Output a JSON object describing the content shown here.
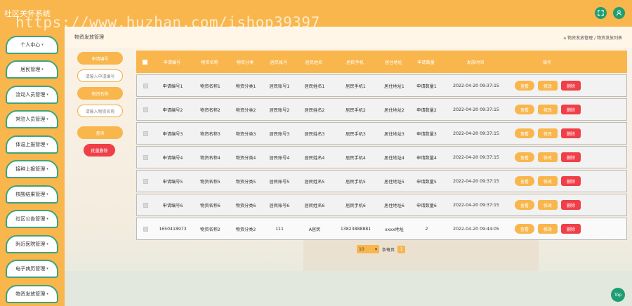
{
  "app": {
    "title": "社区关怀系统",
    "watermark": "https://www.huzhan.com/ishop39397"
  },
  "topbar": {
    "icons": [
      "fullscreen-icon",
      "user-icon"
    ]
  },
  "sidebar": {
    "items": [
      {
        "label": "个人中心"
      },
      {
        "label": "居民管理"
      },
      {
        "label": "流动人员管理"
      },
      {
        "label": "常驻人员管理"
      },
      {
        "label": "体温上报管理"
      },
      {
        "label": "接种上报管理"
      },
      {
        "label": "核酸结果管理"
      },
      {
        "label": "社区公告管理"
      },
      {
        "label": "附近医院管理"
      },
      {
        "label": "电子病历管理"
      },
      {
        "label": "物资发放管理"
      }
    ]
  },
  "page": {
    "title": "物资发放管理",
    "breadcrumb": "物资发放管理 / 物资发放列表"
  },
  "filter": {
    "field1_label": "申请编号",
    "field1_placeholder": "请输入申请编号",
    "field2_label": "物资名称",
    "field2_placeholder": "请输入物资名称",
    "search_label": "查询",
    "bulk_delete_label": "批量删除"
  },
  "table": {
    "headers": [
      "申请编号",
      "物资名称",
      "物资分类",
      "居民账号",
      "居民姓名",
      "居民手机",
      "居住地址",
      "申请数量",
      "发放时间",
      "操作"
    ],
    "rows": [
      [
        "申请编号1",
        "物资名称1",
        "物资分类1",
        "居民账号1",
        "居民姓名1",
        "居民手机1",
        "居住地址1",
        "申请数量1",
        "2022-04-20 09:37:15"
      ],
      [
        "申请编号2",
        "物资名称2",
        "物资分类2",
        "居民账号2",
        "居民姓名2",
        "居民手机2",
        "居住地址2",
        "申请数量2",
        "2022-04-20 09:37:15"
      ],
      [
        "申请编号3",
        "物资名称3",
        "物资分类3",
        "居民账号3",
        "居民姓名3",
        "居民手机3",
        "居住地址3",
        "申请数量3",
        "2022-04-20 09:37:15"
      ],
      [
        "申请编号4",
        "物资名称4",
        "物资分类4",
        "居民账号4",
        "居民姓名4",
        "居民手机4",
        "居住地址4",
        "申请数量4",
        "2022-04-20 09:37:15"
      ],
      [
        "申请编号5",
        "物资名称5",
        "物资分类5",
        "居民账号5",
        "居民姓名5",
        "居民手机5",
        "居住地址5",
        "申请数量5",
        "2022-04-20 09:37:15"
      ],
      [
        "申请编号6",
        "物资名称6",
        "物资分类6",
        "居民账号6",
        "居民姓名6",
        "居民手机6",
        "居住地址6",
        "申请数量6",
        "2022-04-20 09:37:15"
      ],
      [
        "1650418973",
        "物资名称2",
        "物资分类2",
        "111",
        "A居民",
        "13823888881",
        "xxxx地址",
        "2",
        "2022-04-20 09:44:05"
      ]
    ],
    "actions": {
      "view": "查看",
      "edit": "修改",
      "delete": "删除"
    }
  },
  "pagination": {
    "page_size": "10",
    "per_page_label": "条每页",
    "current_page": "1"
  },
  "back_to_top": "Top",
  "colors": {
    "primary": "#f8b64c",
    "accent": "#1e9e72",
    "danger": "#ef3f48"
  }
}
